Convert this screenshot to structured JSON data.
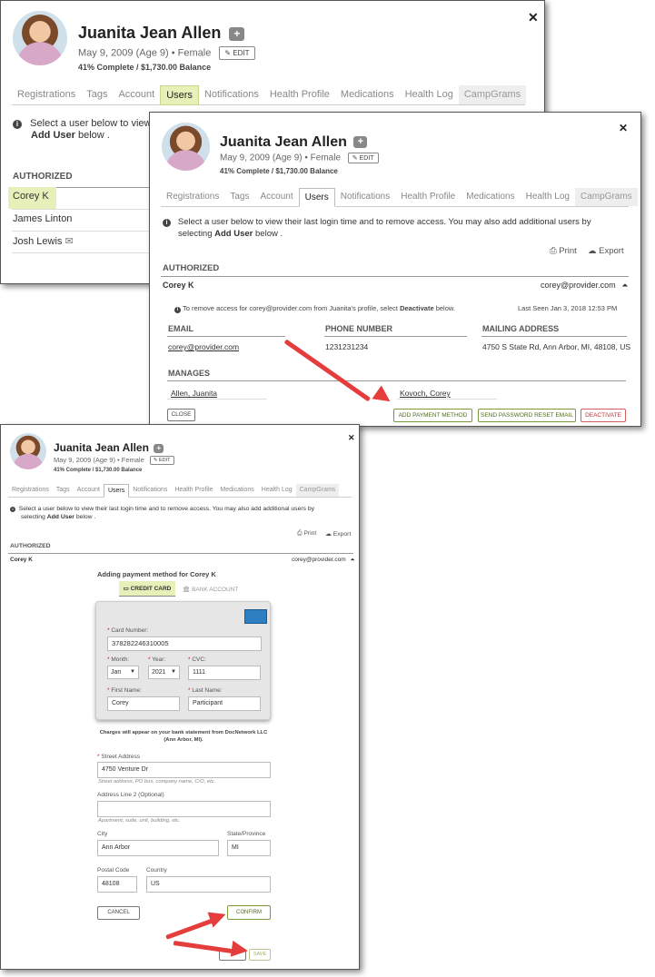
{
  "profile": {
    "name": "Juanita Jean Allen",
    "dob_line": "May 9, 2009 (Age 9) • Female",
    "edit_label": "EDIT",
    "balance_line": "41% Complete / $1,730.00 Balance"
  },
  "tabs": [
    "Registrations",
    "Tags",
    "Account",
    "Users",
    "Notifications",
    "Health Profile",
    "Medications",
    "Health Log",
    "CampGrams"
  ],
  "panel1": {
    "select_text_1": "Select a user below to view",
    "select_text_2_bold": "Add User",
    "select_text_2_rest": " below .",
    "authorized_title": "AUTHORIZED",
    "users": [
      "Corey K",
      "James Linton",
      "Josh Lewis"
    ]
  },
  "panel2": {
    "instruction_1": "Select a user below to view their last login time and to remove access. You may also add additional users by",
    "instruction_2_pre": "selecting ",
    "instruction_2_bold": "Add User",
    "instruction_2_post": " below .",
    "print_label": "Print",
    "export_label": "Export",
    "authorized_title": "AUTHORIZED",
    "user_name": "Corey K",
    "user_email": "corey@provider.com",
    "remove_note_pre": "To remove access for corey@provider.com from Juanita's profile, select ",
    "remove_note_bold": "Deactivate",
    "remove_note_post": " below.",
    "last_seen": "Last Seen Jan 3, 2018 12:53 PM",
    "email_header": "EMAIL",
    "phone_header": "PHONE NUMBER",
    "address_header": "MAILING ADDRESS",
    "email_value": "corey@provider.com",
    "phone_value": "1231231234",
    "address_value": "4750 S State Rd, Ann Arbor, MI, 48108, US",
    "manages_title": "MANAGES",
    "manages": [
      "Allen, Juanita",
      "Kovoch, Corey"
    ],
    "close_label": "CLOSE",
    "add_payment_label": "ADD PAYMENT METHOD",
    "reset_label": "SEND PASSWORD RESET EMAIL",
    "deactivate_label": "DEACTIVATE"
  },
  "panel3": {
    "instruction_1": "Select a user below to view their last login time and to remove access. You may also add additional users by",
    "instruction_2_pre": "selecting ",
    "instruction_2_bold": "Add User",
    "instruction_2_post": " below .",
    "print_label": "Print",
    "export_label": "Export",
    "authorized_title": "AUTHORIZED",
    "user_name": "Corey K",
    "user_email": "corey@provider.com",
    "adding_title": "Adding payment method for Corey K",
    "credit_card_tab": "CREDIT CARD",
    "bank_account_tab": "BANK ACCOUNT",
    "card_number_label": "Card Number:",
    "card_number": "378282246310005",
    "month_label": "Month:",
    "month_value": "Jan",
    "year_label": "Year:",
    "year_value": "2021",
    "cvc_label": "CVC:",
    "cvc_value": "1111",
    "first_name_label": "First Name:",
    "first_name": "Corey",
    "last_name_label": "Last Name:",
    "last_name": "Participant",
    "charges_note_1": "Charges will appear on your bank statement from DocNetwork LLC",
    "charges_note_2": "(Ann Arbor, MI).",
    "street_label": "Street Address",
    "street_value": "4750 Venture Dr",
    "street_hint": "Street address, PO box, company name, C/O, etc.",
    "line2_label": "Address Line 2 (Optional)",
    "line2_value": "",
    "line2_hint": "Apartment, suite, unit, building, etc.",
    "city_label": "City",
    "city_value": "Ann Arbor",
    "state_label": "State/Province",
    "state_value": "MI",
    "postal_label": "Postal Code",
    "postal_value": "48108",
    "country_label": "Country",
    "country_value": "US",
    "cancel_label": "CANCEL",
    "confirm_label": "CONFIRM",
    "save_label": "SAVE"
  },
  "colors": {
    "highlight": "#e7f0b8",
    "arrow": "#e53c3c",
    "green_button": "#4d6b1a",
    "red_button": "#c03030"
  }
}
